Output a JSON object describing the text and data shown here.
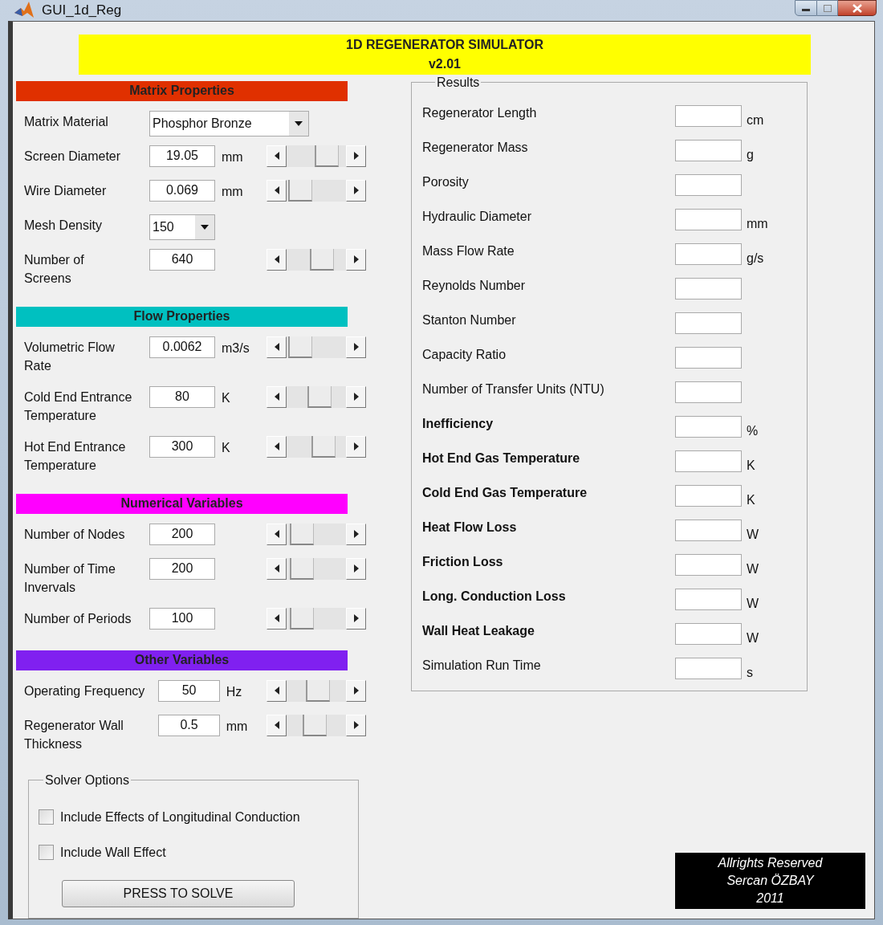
{
  "window": {
    "title": "GUI_1d_Reg"
  },
  "banner": {
    "title": "1D REGENERATOR SIMULATOR",
    "version": "v2.01"
  },
  "sections": [
    {
      "heading": "Matrix Properties",
      "color": "#e03000",
      "rows": [
        {
          "kind": "dropdown",
          "label": "Matrix Material",
          "value": "Phosphor Bronze"
        },
        {
          "kind": "slider",
          "label": "Screen Diameter",
          "value": "19.05",
          "unit": "mm",
          "level": 0.8
        },
        {
          "kind": "slider",
          "label": "Wire Diameter",
          "value": "0.069",
          "unit": "mm",
          "level": 0.05
        },
        {
          "kind": "dropdown",
          "label": "Mesh Density",
          "value": "150"
        },
        {
          "kind": "slider",
          "label": "Number of Screens",
          "value": "640",
          "unit": "",
          "level": 0.65
        }
      ]
    },
    {
      "heading": "Flow Properties",
      "color": "#00c0c0",
      "rows": [
        {
          "kind": "slider",
          "label": "Volumetric Flow Rate",
          "value": "0.0062",
          "unit": "m3/s",
          "level": 0.05
        },
        {
          "kind": "slider",
          "label": "Cold End Entrance Temperature",
          "value": "80",
          "unit": "K",
          "level": 0.6
        },
        {
          "kind": "slider",
          "label": "Hot End Entrance Temperature",
          "value": "300",
          "unit": "K",
          "level": 0.7
        }
      ]
    },
    {
      "heading": "Numerical Variables",
      "color": "#ff00ff",
      "rows": [
        {
          "kind": "slider",
          "label": "Number of Nodes",
          "value": "200",
          "unit": "",
          "level": 0.1
        },
        {
          "kind": "slider",
          "label": "Number of Time Invervals",
          "value": "200",
          "unit": "",
          "level": 0.1
        },
        {
          "kind": "slider",
          "label": "Number of Periods",
          "value": "100",
          "unit": "",
          "level": 0.1
        }
      ]
    },
    {
      "heading": "Other Variables",
      "color": "#8020f0",
      "rows": [
        {
          "kind": "slider",
          "label": "Operating Frequency",
          "value": "50",
          "unit": "Hz",
          "level": 0.55
        },
        {
          "kind": "slider",
          "label": "Regenerator Wall Thickness",
          "value": "0.5",
          "unit": "mm",
          "level": 0.45
        }
      ]
    }
  ],
  "solver_options": {
    "title": "Solver Options",
    "checkboxes": [
      {
        "label": "Include Effects of Longitudinal Conduction",
        "checked": false
      },
      {
        "label": "Include Wall Effect",
        "checked": false
      }
    ],
    "button": "PRESS TO SOLVE"
  },
  "results": {
    "title": "Results",
    "rows": [
      {
        "label": "Regenerator Length",
        "unit": "cm",
        "bold": false
      },
      {
        "label": "Regenerator Mass",
        "unit": "g",
        "bold": false
      },
      {
        "label": "Porosity",
        "bold": false
      },
      {
        "label": "Hydraulic Diameter",
        "unit": "mm",
        "bold": false
      },
      {
        "label": "Mass Flow Rate",
        "unit": "g/s",
        "bold": false
      },
      {
        "label": "Reynolds Number",
        "bold": false
      },
      {
        "label": "Stanton Number",
        "bold": false
      },
      {
        "label": "Capacity Ratio",
        "bold": false
      },
      {
        "label": "Number of Transfer Units (NTU)",
        "bold": false
      },
      {
        "label": "Inefficiency",
        "unit": "%",
        "bold": true
      },
      {
        "label": "Hot End Gas Temperature",
        "unit": "K",
        "bold": true
      },
      {
        "label": "Cold End Gas Temperature",
        "unit": "K",
        "bold": true
      },
      {
        "label": "Heat Flow Loss",
        "unit": "W",
        "bold": true
      },
      {
        "label": "Friction Loss",
        "unit": "W",
        "bold": true
      },
      {
        "label": "Long. Conduction Loss",
        "unit": "W",
        "bold": true
      },
      {
        "label": "Wall Heat Leakage",
        "unit": "W",
        "bold": true
      },
      {
        "label": "Simulation Run Time",
        "unit": "s",
        "bold": false
      }
    ]
  },
  "copyright": [
    "Allrights Reserved",
    "Sercan ÖZBAY",
    "2011"
  ]
}
